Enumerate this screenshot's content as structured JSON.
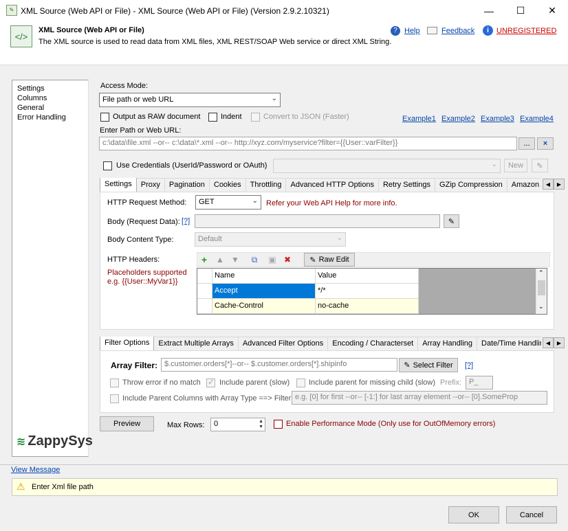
{
  "window": {
    "title": "XML Source (Web API or File) - XML Source (Web API or File) (Version 2.9.2.10321)"
  },
  "header": {
    "title": "XML Source (Web API or File)",
    "description": "The XML source is used to read data from XML files, XML REST/SOAP Web service or direct XML String.",
    "help": "Help",
    "feedback": "Feedback",
    "unregistered": "UNREGISTERED"
  },
  "sidebar": {
    "items": [
      {
        "label": "Settings"
      },
      {
        "label": "Columns"
      },
      {
        "label": "General"
      },
      {
        "label": "Error Handling"
      }
    ]
  },
  "main": {
    "access_mode_label": "Access Mode:",
    "access_mode_value": "File path or web URL",
    "output_raw_label": "Output as RAW document",
    "indent_label": "Indent",
    "convert_json_label": "Convert to JSON (Faster)",
    "examples": [
      "Example1",
      "Example2",
      "Example3",
      "Example4"
    ],
    "path_label": "Enter Path or Web URL:",
    "path_placeholder": "c:\\data\\file.xml --or-- c:\\data\\*.xml --or-- http://xyz.com/myservice?filter={{User::varFilter}}",
    "browse_label": "...",
    "use_credentials_label": "Use Credentials (UserId/Password or OAuth)",
    "new_label": "New"
  },
  "http_tabs": [
    "Settings",
    "Proxy",
    "Pagination",
    "Cookies",
    "Throttling",
    "Advanced HTTP Options",
    "Retry Settings",
    "GZip Compression",
    "Amazon A"
  ],
  "http": {
    "method_label": "HTTP Request Method:",
    "method_value": "GET",
    "help_text": "Refer your Web API Help for more info.",
    "body_label": "Body (Request Data):",
    "body_help": "[?]",
    "content_type_label": "Body Content Type:",
    "content_type_value": "Default",
    "headers_label": "HTTP Headers:",
    "raw_edit_label": "Raw Edit",
    "placeholders_line1": "Placeholders supported",
    "placeholders_line2": "e.g. {{User::MyVar1}}",
    "headers_columns": [
      "Name",
      "Value"
    ],
    "headers_rows": [
      {
        "name": "Accept",
        "value": "*/*"
      },
      {
        "name": "Cache-Control",
        "value": "no-cache"
      }
    ]
  },
  "filter_tabs": [
    "Filter Options",
    "Extract Multiple Arrays",
    "Advanced Filter Options",
    "Encoding / Characterset",
    "Array Handling",
    "Date/Time Handlin"
  ],
  "filter": {
    "array_filter_label": "Array Filter:",
    "array_filter_placeholder": "$.customer.orders[*]--or-- $.customer.orders[*].shipinfo",
    "select_filter_label": "Select Filter",
    "help": "[?]",
    "throw_error_label": "Throw error if no match",
    "include_parent_label": "Include parent (slow)",
    "include_parent_missing_label": "Include parent for missing child (slow)",
    "prefix_label": "Prefix:",
    "prefix_value": "P_",
    "include_parent_columns_label": "Include Parent Columns with Array Type ==> Filter :",
    "parent_filter_placeholder": "e.g. [0] for first --or-- [-1:] for last array element --or-- [0].SomeProp"
  },
  "bottom": {
    "preview_label": "Preview",
    "max_rows_label": "Max Rows:",
    "max_rows_value": "0",
    "perf_mode_label": "Enable Performance Mode (Only use for OutOfMemory errors)",
    "logo_text": "ZappySys",
    "view_message": "View Message",
    "status_message": "Enter Xml file path",
    "ok_label": "OK",
    "cancel_label": "Cancel"
  },
  "colors": {
    "accent_blue": "#0645ad",
    "unregistered_red": "#cc0000",
    "selected_cell": "#0078d7",
    "value_cell": "#ffffe1",
    "status_bg": "#ffffe1"
  }
}
